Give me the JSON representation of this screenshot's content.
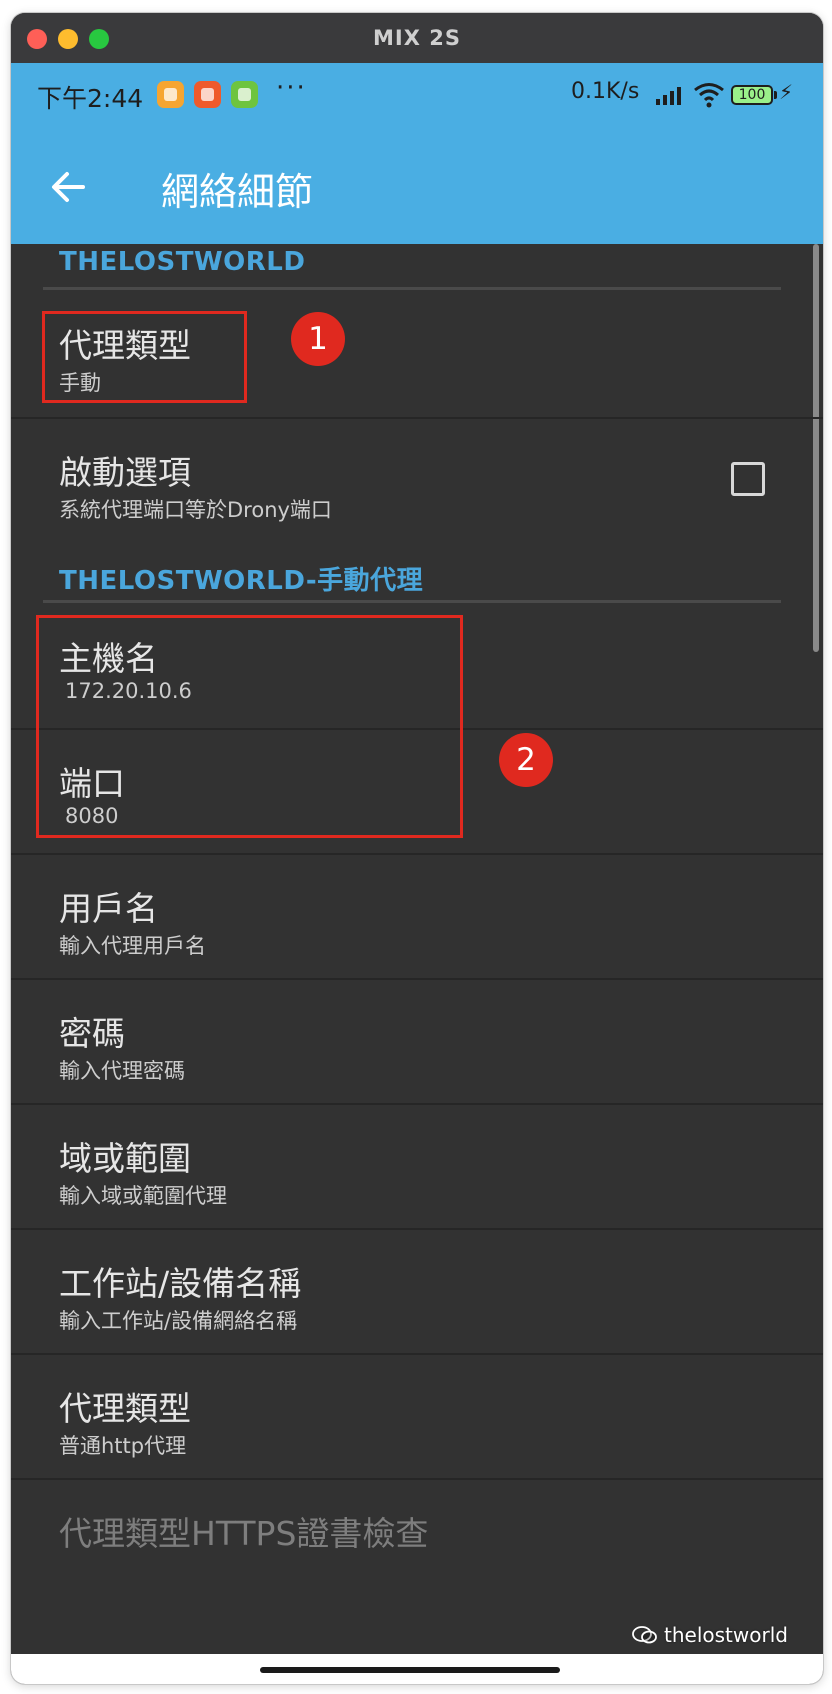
{
  "window": {
    "title": "MIX 2S"
  },
  "status_bar": {
    "time": "下午2:44",
    "more": "···",
    "net_speed": "0.1K/s",
    "battery": "100",
    "charging_symbol": "⚡",
    "notification_icons": [
      "orange-app-icon",
      "red-app-icon",
      "green-app-icon"
    ]
  },
  "app_bar": {
    "title": "網絡細節",
    "back_icon": "arrow-left-icon"
  },
  "sections": [
    {
      "header": "THELOSTWORLD"
    },
    {
      "header": "THELOSTWORLD-手動代理"
    }
  ],
  "items": {
    "proxy_type": {
      "title": "代理類型",
      "value": "手動"
    },
    "startup": {
      "title": "啟動選項",
      "subtitle": "系統代理端口等於Drony端口",
      "checked": false
    },
    "hostname": {
      "title": "主機名",
      "value": "172.20.10.6"
    },
    "port": {
      "title": "端口",
      "value": "8080"
    },
    "username": {
      "title": "用戶名",
      "subtitle": "輸入代理用戶名"
    },
    "password": {
      "title": "密碼",
      "subtitle": "輸入代理密碼"
    },
    "domain": {
      "title": "域或範圍",
      "subtitle": "輸入域或範圍代理"
    },
    "workstation": {
      "title": "工作站/設備名稱",
      "subtitle": "輸入工作站/設備網絡名稱"
    },
    "proxy_kind": {
      "title": "代理類型",
      "subtitle": "普通http代理"
    },
    "https_check": {
      "title": "代理類型HTTPS證書檢查"
    }
  },
  "annotations": {
    "badge1": "1",
    "badge2": "2",
    "color": "#e0291f"
  },
  "watermark": {
    "text": "thelostworld"
  },
  "colors": {
    "accent": "#4aaee3",
    "section_header": "#4aa6dc",
    "background": "#323232"
  }
}
